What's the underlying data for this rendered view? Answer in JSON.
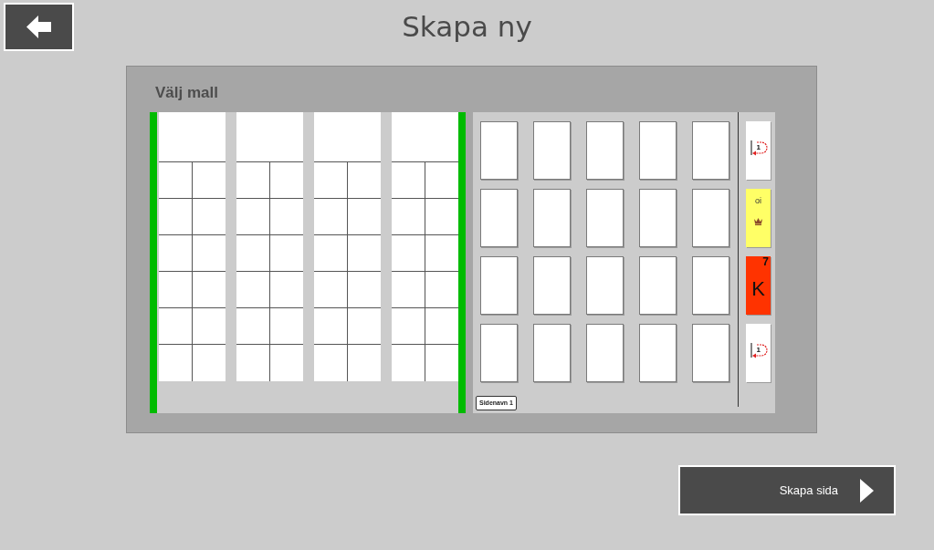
{
  "header": {
    "title": "Skapa ny"
  },
  "template_picker": {
    "heading": "Välj mall",
    "templates": [
      {
        "kind": "header-grid"
      },
      {
        "kind": "header-grid"
      },
      {
        "kind": "header-grid"
      },
      {
        "kind": "header-grid"
      }
    ]
  },
  "page_preview": {
    "page_name": "Sidenavn 1",
    "side_cards": [
      {
        "kind": "page-link",
        "color": "#ffffff",
        "number": "1"
      },
      {
        "kind": "symbol",
        "color": "#ffff66",
        "label": "oi"
      },
      {
        "kind": "category",
        "color": "#ff3300",
        "number": "7",
        "letter": "K"
      },
      {
        "kind": "page-link",
        "color": "#ffffff",
        "number": "1"
      }
    ]
  },
  "create_button": {
    "label": "Skapa sida"
  }
}
